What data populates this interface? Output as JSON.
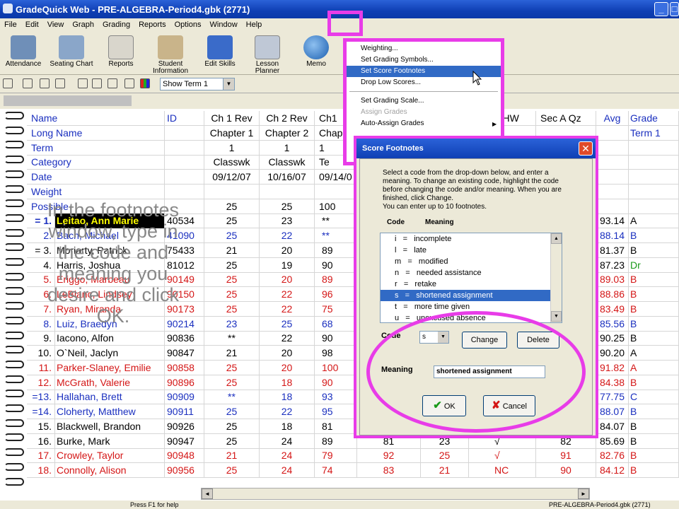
{
  "window": {
    "title": "GradeQuick Web - PRE-ALGEBRA-Period4.gbk (2771)"
  },
  "menubar": [
    "File",
    "Edit",
    "View",
    "Graph",
    "Grading",
    "Reports",
    "Options",
    "Window",
    "Help"
  ],
  "toolbar": [
    "Attendance",
    "Seating Chart",
    "Reports",
    "Student Information",
    "Edit Skills",
    "Lesson Planner",
    "Memo"
  ],
  "term_select": "Show Term 1",
  "grid": {
    "label_rows": [
      {
        "label": "Name",
        "id": "ID",
        "ch1rev": "Ch 1 Rev",
        "ch2rev": "Ch 2 Rev",
        "ch1": "Ch1",
        "ahw": "A HW",
        "secaqz": "Sec A Qz",
        "avg": "Avg",
        "grade": "Grade"
      },
      {
        "label": "Long Name",
        "id": "",
        "ch1rev": "Chapter 1",
        "ch2rev": "Chapter 2",
        "ch1": "Chap",
        "ahw": "",
        "secaqz": "",
        "avg": "",
        "grade": "Term 1"
      },
      {
        "label": "Term",
        "id": "",
        "ch1rev": "1",
        "ch2rev": "1",
        "ch1": "1",
        "ahw": "",
        "secaqz": "",
        "avg": "",
        "grade": ""
      },
      {
        "label": "Category",
        "id": "",
        "ch1rev": "Classwk",
        "ch2rev": "Classwk",
        "ch1": "Te",
        "ahw": "",
        "secaqz": "",
        "avg": "",
        "grade": ""
      },
      {
        "label": "Date",
        "id": "",
        "ch1rev": "09/12/07",
        "ch2rev": "10/16/07",
        "ch1": "09/14/0",
        "ahw": "",
        "secaqz": "",
        "avg": "",
        "grade": ""
      },
      {
        "label": "Weight",
        "id": "",
        "ch1rev": "",
        "ch2rev": "",
        "ch1": "",
        "ahw": "",
        "secaqz": "",
        "avg": "",
        "grade": ""
      },
      {
        "label": "Possible",
        "id": "",
        "ch1rev": "25",
        "ch2rev": "25",
        "ch1": "100",
        "ahw": "",
        "secaqz": "",
        "avg": "",
        "grade": ""
      }
    ],
    "students": [
      {
        "num": "= 1.",
        "name": "Leitao, Ann Marie",
        "id": "40534",
        "c1": "25",
        "c2": "23",
        "c3": "**",
        "c4": "",
        "c5": "",
        "c6": "",
        "c7": "",
        "avg": "93.14",
        "grade": "A",
        "color": "blk"
      },
      {
        "num": "2.",
        "name": "Bach, Michael",
        "id": "41090",
        "c1": "25",
        "c2": "22",
        "c3": "**",
        "c4": "",
        "c5": "",
        "c6": "",
        "c7": "",
        "avg": "88.14",
        "grade": "B",
        "color": "blue"
      },
      {
        "num": "= 3.",
        "name": "Moriarty, Patrick",
        "id": "75433",
        "c1": "21",
        "c2": "20",
        "c3": "89",
        "c4": "",
        "c5": "",
        "c6": "",
        "c7": "",
        "avg": "81.37",
        "grade": "B",
        "color": "blk"
      },
      {
        "num": "4.",
        "name": "Harris, Joshua",
        "id": "81012",
        "c1": "25",
        "c2": "19",
        "c3": "90",
        "c4": "",
        "c5": "",
        "c6": "",
        "c7": "",
        "avg": "87.23",
        "grade": "Dr",
        "color": "blk"
      },
      {
        "num": "5.",
        "name": "Eriggo, Marbeau",
        "id": "90149",
        "c1": "25",
        "c2": "20",
        "c3": "89",
        "c4": "",
        "c5": "",
        "c6": "",
        "c7": "",
        "avg": "89.03",
        "grade": "B",
        "color": "red"
      },
      {
        "num": "6.",
        "name": "LeBlanc, Lindsey",
        "id": "90150",
        "c1": "25",
        "c2": "22",
        "c3": "96",
        "c4": "",
        "c5": "",
        "c6": "",
        "c7": "",
        "avg": "88.86",
        "grade": "B",
        "color": "red"
      },
      {
        "num": "7.",
        "name": "Ryan, Miranda",
        "id": "90173",
        "c1": "25",
        "c2": "22",
        "c3": "75",
        "c4": "",
        "c5": "",
        "c6": "",
        "c7": "",
        "avg": "83.49",
        "grade": "B",
        "color": "red"
      },
      {
        "num": "8.",
        "name": "Luiz, Braedyn",
        "id": "90214",
        "c1": "23",
        "c2": "25",
        "c3": "68",
        "c4": "",
        "c5": "",
        "c6": "",
        "c7": "",
        "avg": "85.56",
        "grade": "B",
        "color": "blue"
      },
      {
        "num": "9.",
        "name": "Iacono, Alfon",
        "id": "90836",
        "c1": "**",
        "c2": "22",
        "c3": "90",
        "c4": "",
        "c5": "",
        "c6": "",
        "c7": "",
        "avg": "90.25",
        "grade": "B",
        "color": "blk"
      },
      {
        "num": "10.",
        "name": "O`Neil, Jaclyn",
        "id": "90847",
        "c1": "21",
        "c2": "20",
        "c3": "98",
        "c4": "",
        "c5": "",
        "c6": "",
        "c7": "",
        "avg": "90.20",
        "grade": "A",
        "color": "blk"
      },
      {
        "num": "11.",
        "name": "Parker-Slaney, Emilie",
        "id": "90858",
        "c1": "25",
        "c2": "20",
        "c3": "100",
        "c4": "",
        "c5": "",
        "c6": "",
        "c7": "",
        "avg": "91.82",
        "grade": "A",
        "color": "red"
      },
      {
        "num": "12.",
        "name": "McGrath, Valerie",
        "id": "90896",
        "c1": "25",
        "c2": "18",
        "c3": "90",
        "c4": "",
        "c5": "",
        "c6": "",
        "c7": "",
        "avg": "84.38",
        "grade": "B",
        "color": "red"
      },
      {
        "num": "=13.",
        "name": "Hallahan, Brett",
        "id": "90909",
        "c1": "**",
        "c2": "18",
        "c3": "93",
        "c4": "",
        "c5": "",
        "c6": "",
        "c7": "",
        "avg": "77.75",
        "grade": "C",
        "color": "blue"
      },
      {
        "num": "=14.",
        "name": "Cloherty, Matthew",
        "id": "90911",
        "c1": "25",
        "c2": "22",
        "c3": "95",
        "c4": "",
        "c5": "",
        "c6": "",
        "c7": "",
        "avg": "88.07",
        "grade": "B",
        "color": "blue"
      },
      {
        "num": "15.",
        "name": "Blackwell, Brandon",
        "id": "90926",
        "c1": "25",
        "c2": "18",
        "c3": "81",
        "c4": "",
        "c5": "",
        "c6": "",
        "c7": "",
        "avg": "84.07",
        "grade": "B",
        "color": "blk"
      },
      {
        "num": "16.",
        "name": "Burke, Mark",
        "id": "90947",
        "c1": "25",
        "c2": "24",
        "c3": "89",
        "c4": "81",
        "c5": "23",
        "c6": "√",
        "c7": "82",
        "avg": "85.69",
        "grade": "B",
        "color": "blk"
      },
      {
        "num": "17.",
        "name": "Crowley, Taylor",
        "id": "90948",
        "c1": "21",
        "c2": "24",
        "c3": "79",
        "c4": "92",
        "c5": "25",
        "c6": "√",
        "c7": "91",
        "avg": "82.76",
        "grade": "B",
        "color": "red"
      },
      {
        "num": "18.",
        "name": "Connolly, Alison",
        "id": "90956",
        "c1": "25",
        "c2": "24",
        "c3": "74",
        "c4": "83",
        "c5": "21",
        "c6": "NC",
        "c7": "90",
        "avg": "84.12",
        "grade": "B",
        "color": "red"
      }
    ]
  },
  "grading_menu": {
    "items": [
      "Weighting...",
      "Set Grading Symbols...",
      "Set Score Footnotes",
      "Drop Low Scores...",
      "Set Grading Scale...",
      "Assign Grades",
      "Auto-Assign Grades"
    ]
  },
  "dialog": {
    "title": "Score Footnotes",
    "instructions": "Select a code from the drop-down below, and enter a meaning.  To change an existing code, highlight the code before changing the code and/or meaning.  When you are finished, click Change.\nYou can enter up to 10 footnotes.",
    "col_code": "Code",
    "col_meaning": "Meaning",
    "footnotes": [
      "i   =   incomplete",
      "l   =   late",
      "m   =   modified",
      "n   =   needed assistance",
      "r   =   retake",
      "s   =   shortened assignment",
      "t   =   more time given",
      "u   =   unexcused absence"
    ],
    "code_label": "Code",
    "code_value": "s",
    "change_button": "Change",
    "delete_button": "Delete",
    "meaning_label": "Meaning",
    "meaning_value": "shortened assignment",
    "ok_button": "OK",
    "cancel_button": "Cancel"
  },
  "overlay_text": "In the footnotes window, type in the code and meaning you desire and click OK.",
  "status": {
    "left": "Press F1 for help",
    "right": "PRE-ALGEBRA-Period4.gbk (2771)"
  }
}
